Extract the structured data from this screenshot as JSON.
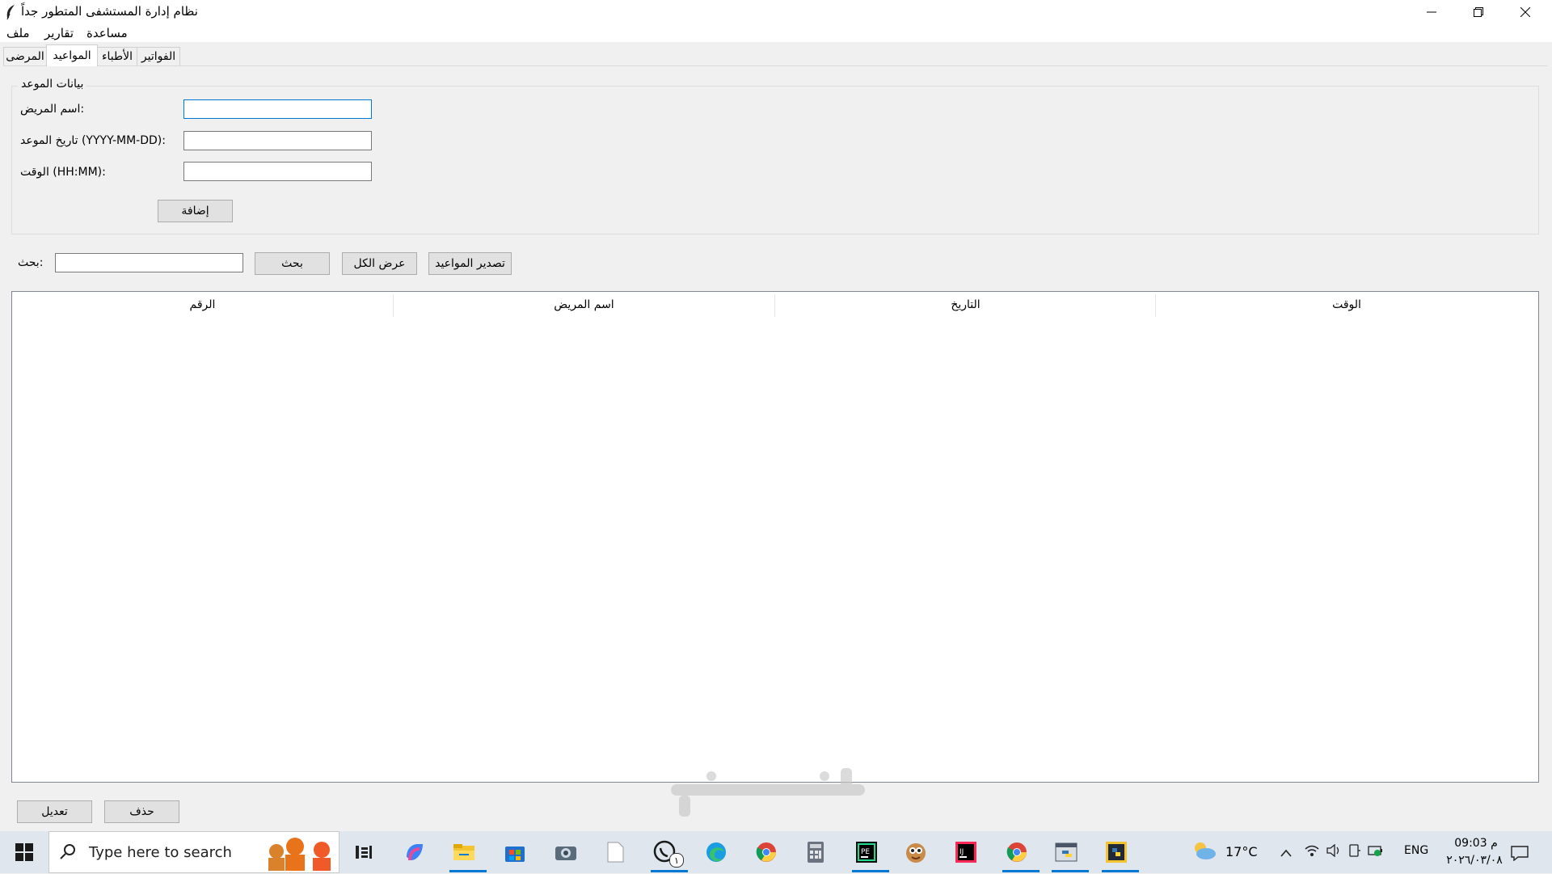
{
  "window": {
    "title": "نظام إدارة المستشفى المتطور جداً"
  },
  "menu": [
    "ملف",
    "تقارير",
    "مساعدة"
  ],
  "tabs": [
    "المرضى",
    "المواعيد",
    "الأطباء",
    "الفواتير"
  ],
  "active_tab": "المواعيد",
  "form": {
    "group_title": "بيانات الموعد",
    "patient_label": "اسم المريض:",
    "date_label": "تاريخ الموعد (YYYY-MM-DD):",
    "time_label": "الوقت (HH:MM):",
    "patient_value": "",
    "date_value": "",
    "time_value": "",
    "add_button": "إضافة"
  },
  "search": {
    "label": "بحث:",
    "value": "",
    "search_button": "بحث",
    "show_all_button": "عرض الكل",
    "export_button": "تصدير المواعيد"
  },
  "table": {
    "columns": [
      "الرقم",
      "اسم المريض",
      "التاريخ",
      "الوقت"
    ],
    "rows": []
  },
  "actions": {
    "edit_button": "تعديل",
    "delete_button": "حذف"
  },
  "watermark": "مستقل",
  "taskbar": {
    "search_placeholder": "Type here to search",
    "weather": "17°C",
    "language": "ENG",
    "time": "09:03 م",
    "date": "٢٠٢٦/٠٣/٠٨",
    "whatsapp_badge": "١"
  }
}
